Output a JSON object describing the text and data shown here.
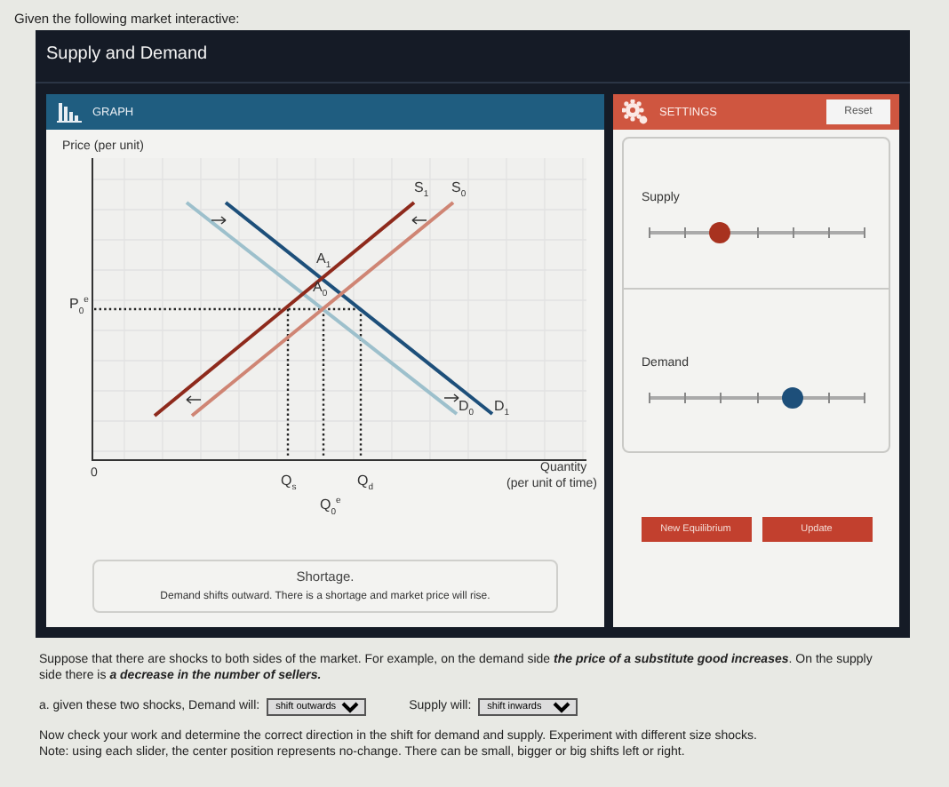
{
  "intro": "Given the following market interactive:",
  "window": {
    "title": "Supply and Demand"
  },
  "graph_panel": {
    "title": "GRAPH",
    "y_axis_label": "Price (per unit)",
    "x_axis_label": "Quantity",
    "x_axis_unit": "(per unit of time)",
    "origin": "0",
    "labels": [
      "S$_{1}$",
      "S$_{0}$",
      "A$_{1}$",
      "A$_{0}$",
      "D$_{0}$",
      "D$_{1}$",
      "P$_{0}$$^{e}$",
      "Q$_{s}$",
      "Q$_{d}$",
      "Q$_{0}$$^{e}$"
    ]
  },
  "status": {
    "title": "Shortage.",
    "message": "Demand shifts outward. There is a shortage and market price will rise."
  },
  "settings": {
    "title": "SETTINGS",
    "reset": "Reset",
    "sliders": [
      {
        "label": "Supply",
        "level": 0.333,
        "color": "#a8321f"
      },
      {
        "label": "Demand",
        "level": 0.667,
        "color": "#1d4f7a"
      }
    ],
    "buttons": [
      "New Equilibrium",
      "Update"
    ]
  },
  "question": {
    "text": "Suppose that there are shocks to both sides of the market. For example, on the demand side **the price of a substitute good increases**. On the supply side there is **a decrease in the number of sellers.**",
    "prompt": "a. given these two shocks, Demand will:",
    "demand_choice": "shift outwards",
    "supply_prompt": "Supply will:",
    "supply_choice": "shift inwards",
    "notes": [
      "Now check your work and determine the correct direction in the shift for demand and supply. Experiment with different size shocks.",
      "Note: using each slider, the center position represents no-change. There can be small, bigger or big shifts left or right."
    ]
  }
}
